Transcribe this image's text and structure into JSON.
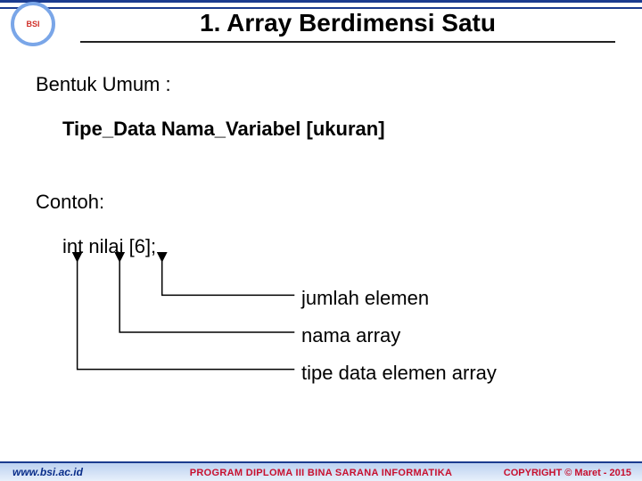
{
  "title": "1. Array Berdimensi Satu",
  "labels": {
    "bentuk": "Bentuk Umum :",
    "contoh": "Contoh:"
  },
  "syntax": "Tipe_Data  Nama_Variabel [ukuran]",
  "example": "int  nilai  [6];",
  "annotations": {
    "jumlah": "jumlah elemen",
    "nama": "nama array",
    "tipe": "tipe data elemen array"
  },
  "footer": {
    "url": "www.bsi.ac.id",
    "program": "PROGRAM DIPLOMA III BINA SARANA INFORMATIKA",
    "copyright": "COPYRIGHT © Maret - 2015"
  },
  "logo_text": "BSI"
}
